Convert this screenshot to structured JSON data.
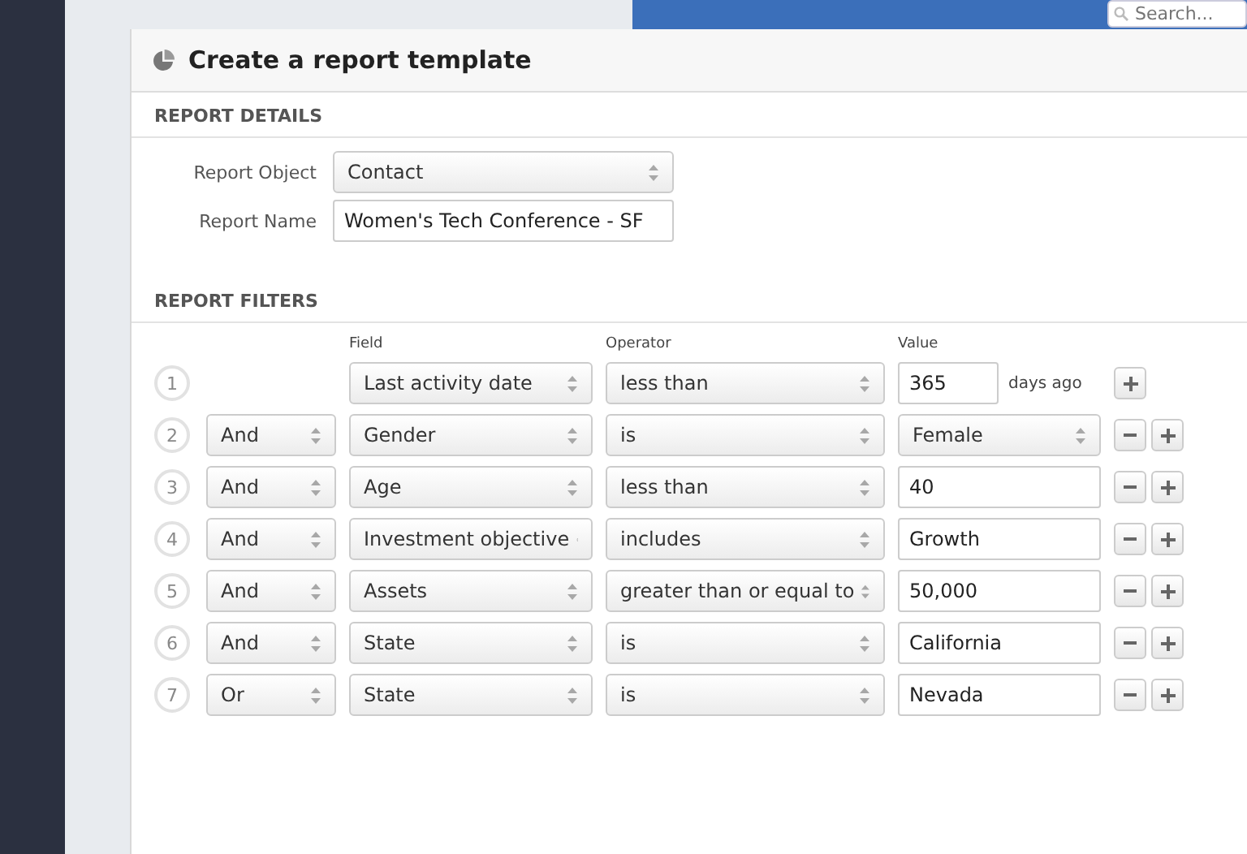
{
  "search": {
    "placeholder": "Search..."
  },
  "page": {
    "title": "Create a report template"
  },
  "report_details": {
    "heading": "REPORT DETAILS",
    "fields": [
      {
        "kind": "select",
        "label": "Report Object",
        "value": "Contact"
      },
      {
        "kind": "input",
        "label": "Report Name",
        "value": "Women's Tech Conference - SF"
      }
    ]
  },
  "report_filters": {
    "heading": "REPORT FILTERS",
    "columns": [
      "Field",
      "Operator",
      "Value"
    ],
    "rows": [
      {
        "number": "1",
        "field": "Last activity date",
        "operator": "less than",
        "value": {
          "kind": "input",
          "text": "365"
        },
        "suffix": "days ago",
        "removable": false
      },
      {
        "number": "2",
        "conjunction": "And",
        "field": "Gender",
        "operator": "is",
        "value": {
          "kind": "select",
          "text": "Female"
        },
        "removable": true
      },
      {
        "number": "3",
        "conjunction": "And",
        "field": "Age",
        "operator": "less than",
        "value": {
          "kind": "input",
          "text": "40"
        },
        "removable": true
      },
      {
        "number": "4",
        "conjunction": "And",
        "field": "Investment objective",
        "operator": "includes",
        "value": {
          "kind": "input",
          "text": "Growth"
        },
        "removable": true
      },
      {
        "number": "5",
        "conjunction": "And",
        "field": "Assets",
        "operator": "greater than or equal to",
        "value": {
          "kind": "input",
          "text": "50,000"
        },
        "removable": true
      },
      {
        "number": "6",
        "conjunction": "And",
        "field": "State",
        "operator": "is",
        "value": {
          "kind": "input",
          "text": "California"
        },
        "removable": true
      },
      {
        "number": "7",
        "conjunction": "Or",
        "field": "State",
        "operator": "is",
        "value": {
          "kind": "input",
          "text": "Nevada"
        },
        "removable": true
      }
    ]
  }
}
